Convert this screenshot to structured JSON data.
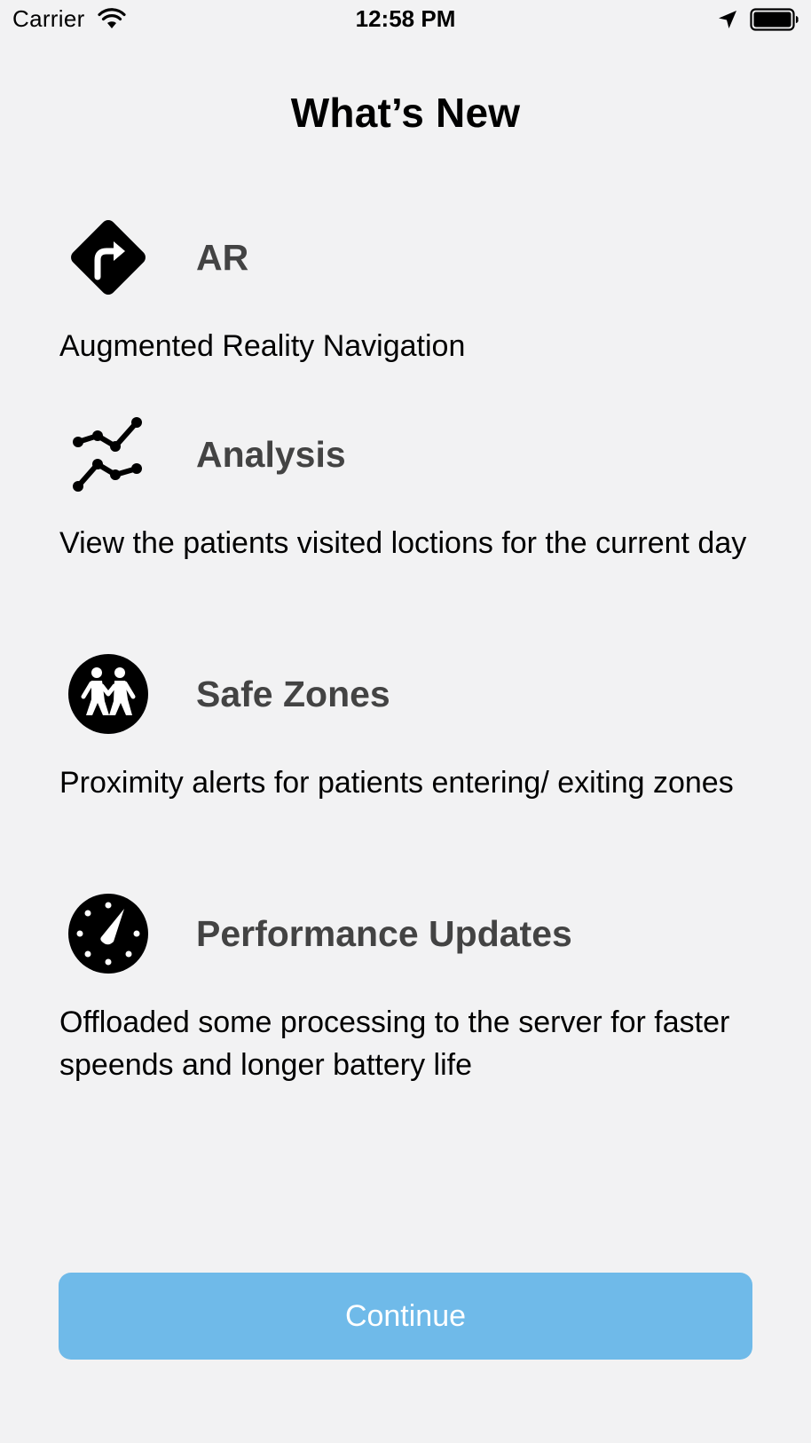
{
  "status_bar": {
    "carrier": "Carrier",
    "time": "12:58 PM",
    "icons": [
      "wifi-icon",
      "location-arrow-icon",
      "battery-icon"
    ]
  },
  "title": "What’s New",
  "features": [
    {
      "icon": "turn-right-sign-icon",
      "title": "AR",
      "description": "Augmented Reality Navigation"
    },
    {
      "icon": "line-chart-icon",
      "title": "Analysis",
      "description": "View the patients visited loctions for the current day"
    },
    {
      "icon": "walking-people-icon",
      "title": "Safe Zones",
      "description": "Proximity alerts for patients entering/ exiting zones"
    },
    {
      "icon": "speedometer-icon",
      "title": "Performance Updates",
      "description": "Offloaded some processing to the server for faster speends and longer battery life"
    }
  ],
  "continue_button": {
    "label": "Continue",
    "color": "#6fbae9",
    "text_color": "#ffffff"
  }
}
